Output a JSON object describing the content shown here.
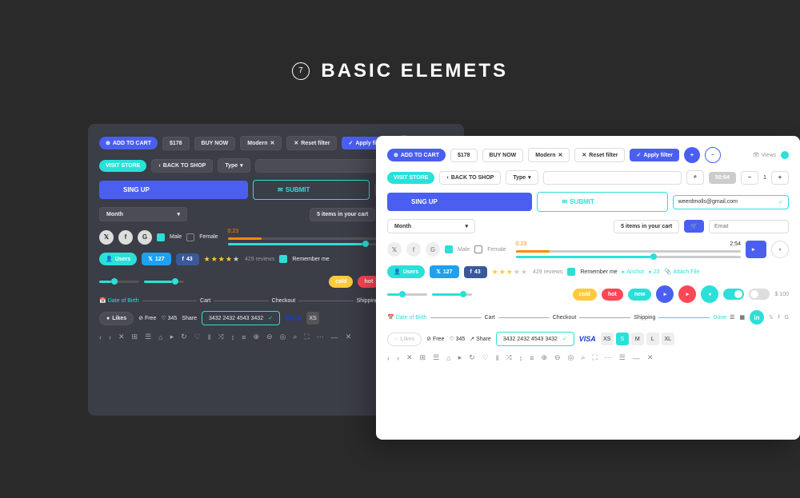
{
  "header": {
    "number": "7",
    "title": "BASIC ELEMETS"
  },
  "common": {
    "addToCart": "ADD TO CART",
    "price": "$178",
    "buyNow": "BUY NOW",
    "modern": "Modern",
    "resetFilter": "Reset filter",
    "applyFilter": "Apply filter",
    "views": "Views",
    "visitStore": "VISIT STORE",
    "backToShop": "BACK TO SHOP",
    "type": "Type",
    "singUp": "SING UP",
    "submit": "SUBMIT",
    "email": "weerdmolls@gmail.com",
    "month": "Month",
    "cartItems": "5 items in your cart",
    "emailPh": "Email",
    "male": "Male",
    "female": "Female",
    "sliderStart": "0:23",
    "sliderEnd": "2:54",
    "users": "Users",
    "tw": "127",
    "fb": "43",
    "reviews": "429 reviews",
    "remember": "Remember me",
    "anchor": "Anchor",
    "attach": "Attach File",
    "tagCold": "cold",
    "tagHot": "hot",
    "tagNew": "new",
    "priceTag": "$ 100",
    "dob": "Date of Birth",
    "cart": "Cart",
    "checkout": "Checkout",
    "shipping": "Shipping",
    "done": "Done",
    "likes": "Likes",
    "free": "Free",
    "likesCount": "345",
    "share": "Share",
    "cardNum": "3432 2432 4543 3432",
    "visa": "VISA",
    "qty": "1",
    "badge": "50:64",
    "p23": "23",
    "sizes": [
      "XS",
      "S",
      "M",
      "L",
      "XL"
    ]
  }
}
